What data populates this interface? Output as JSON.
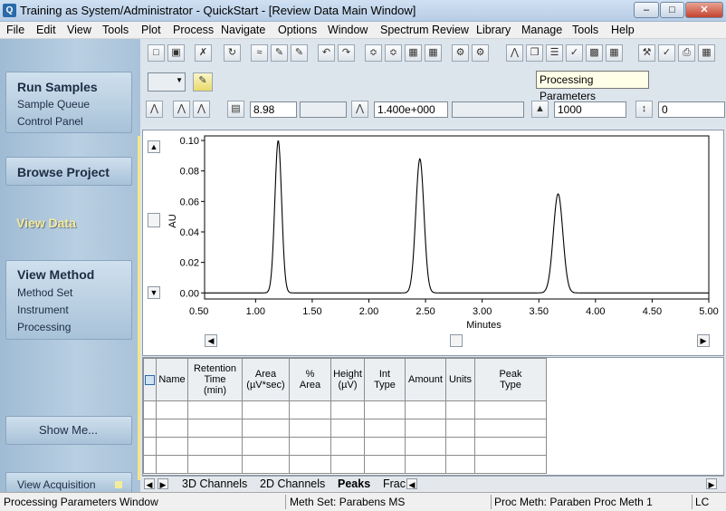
{
  "window": {
    "title": "Training as System/Administrator - QuickStart - [Review Data Main Window]",
    "app_icon": "Q",
    "minimize": "–",
    "maximize": "□",
    "close": "✕"
  },
  "menu": [
    "File",
    "Edit",
    "View",
    "Tools",
    "Plot",
    "Process",
    "Navigate",
    "Options",
    "Window",
    "Spectrum Review",
    "Library",
    "Manage",
    "Tools",
    "Help"
  ],
  "sidebar": {
    "run_samples": {
      "label": "Run Samples",
      "items": [
        "Sample Queue",
        "Control Panel"
      ]
    },
    "browse_project": {
      "label": "Browse Project"
    },
    "view_data": {
      "label": "View Data"
    },
    "view_method": {
      "label": "View Method",
      "items": [
        "Method Set",
        "Instrument",
        "Processing"
      ]
    },
    "show_me": {
      "label": "Show Me..."
    },
    "view_acquisition": {
      "label": "View Acquisition"
    }
  },
  "toolbar": {
    "tooltip": "Processing Parameters",
    "peak_width": "8.98",
    "threshold": "1.400e+000",
    "minimum_area": "1000",
    "minimum_height": "0"
  },
  "chart_data": {
    "type": "line",
    "xlabel": "Minutes",
    "ylabel": "AU",
    "xlim": [
      0.55,
      5.0
    ],
    "ylim": [
      -0.004,
      0.103
    ],
    "x_ticks": [
      "0.50",
      "1.00",
      "1.50",
      "2.00",
      "2.50",
      "3.00",
      "3.50",
      "4.00",
      "4.50",
      "5.00"
    ],
    "y_ticks": [
      "0.00",
      "0.02",
      "0.04",
      "0.06",
      "0.08",
      "0.10"
    ],
    "x_tick_values": [
      0.5,
      1.0,
      1.5,
      2.0,
      2.5,
      3.0,
      3.5,
      4.0,
      4.5,
      5.0
    ],
    "y_tick_values": [
      0.0,
      0.02,
      0.04,
      0.06,
      0.08,
      0.1
    ],
    "peaks": [
      {
        "rt": 1.2,
        "height": 0.1,
        "width": 0.03
      },
      {
        "rt": 2.45,
        "height": 0.088,
        "width": 0.036
      },
      {
        "rt": 3.67,
        "height": 0.065,
        "width": 0.042
      }
    ]
  },
  "peaks_table": {
    "headers": [
      "Name",
      "Retention Time (min)",
      "Area (µV*sec)",
      "% Area",
      "Height (µV)",
      "Int Type",
      "Amount",
      "Units",
      "Peak Type"
    ]
  },
  "tabs": [
    "3D Channels",
    "2D Channels",
    "Peaks",
    "Frac"
  ],
  "status": {
    "left": "Processing Parameters Window",
    "meth_set": "Meth Set: Parabens MS",
    "proc_meth": "Proc Meth: Paraben Proc Meth 1",
    "mode": "LC"
  }
}
